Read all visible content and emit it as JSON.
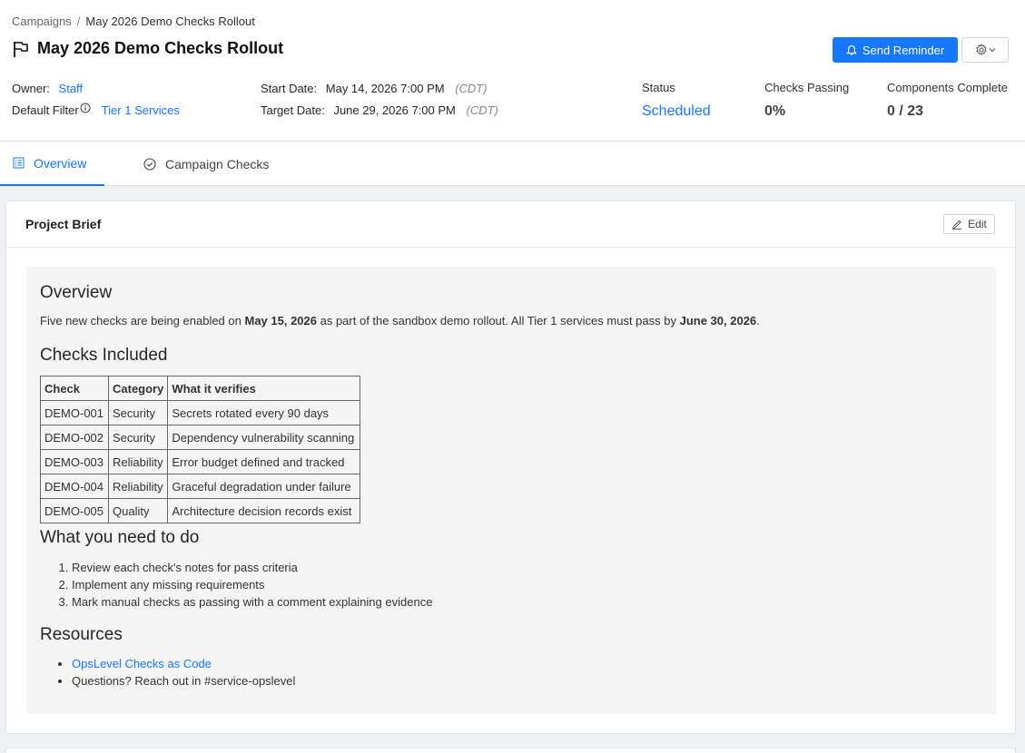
{
  "breadcrumb": {
    "parent": "Campaigns",
    "separator": "/",
    "current": "May 2026 Demo Checks Rollout"
  },
  "page": {
    "title": "May 2026 Demo Checks Rollout"
  },
  "actions": {
    "send_reminder": "Send Reminder"
  },
  "meta": {
    "owner_label": "Owner:",
    "owner_value": "Staff",
    "filter_label": "Default Filter",
    "filter_value": "Tier 1 Services",
    "start_label": "Start Date:",
    "start_value": "May 14, 2026 7:00 PM",
    "start_tz": "(CDT)",
    "target_label": "Target Date:",
    "target_value": "June 29, 2026 7:00 PM",
    "target_tz": "(CDT)"
  },
  "stats": {
    "status_label": "Status",
    "status_value": "Scheduled",
    "passing_label": "Checks Passing",
    "passing_value": "0%",
    "components_label": "Components Complete",
    "components_value": "0 / 23"
  },
  "tabs": [
    {
      "label": "Overview"
    },
    {
      "label": "Campaign Checks"
    }
  ],
  "brief": {
    "card_title": "Project Brief",
    "edit_label": "Edit",
    "overview_heading": "Overview",
    "overview_text_1": "Five new checks are being enabled on ",
    "overview_bold_1": "May 15, 2026",
    "overview_text_2": " as part of the sandbox demo rollout. All Tier 1 services must pass by ",
    "overview_bold_2": "June 30, 2026",
    "overview_text_3": ".",
    "checks_heading": "Checks Included",
    "table_headers": [
      "Check",
      "Category",
      "What it verifies"
    ],
    "table_rows": [
      [
        "DEMO-001",
        "Security",
        "Secrets rotated every 90 days"
      ],
      [
        "DEMO-002",
        "Security",
        "Dependency vulnerability scanning"
      ],
      [
        "DEMO-003",
        "Reliability",
        "Error budget defined and tracked"
      ],
      [
        "DEMO-004",
        "Reliability",
        "Graceful degradation under failure"
      ],
      [
        "DEMO-005",
        "Quality",
        "Architecture decision records exist"
      ]
    ],
    "todo_heading": "What you need to do",
    "todo_items": [
      "Review each check's notes for pass criteria",
      "Implement any missing requirements",
      "Mark manual checks as passing with a comment explaining evidence"
    ],
    "resources_heading": "Resources",
    "resource_link": "OpsLevel Checks as Code",
    "resource_text": "Questions? Reach out in #service-opslevel"
  },
  "icons": {
    "flag": "flag-icon",
    "bell": "bell-icon",
    "gear": "gear-icon",
    "info": "info-icon",
    "overview_tab": "list-icon",
    "checks_tab": "check-circle-icon",
    "edit": "pencil-icon"
  },
  "colors": {
    "accent": "#1677ff"
  }
}
